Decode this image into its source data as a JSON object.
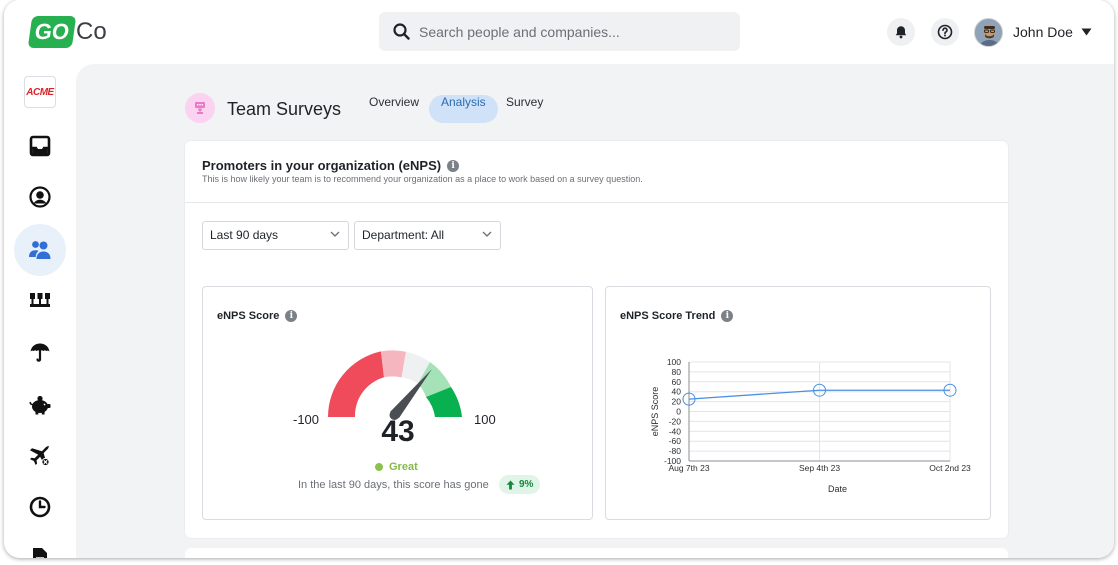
{
  "brand": {
    "logo_go": "GO",
    "logo_co": "Co",
    "company_badge": "ACME"
  },
  "search": {
    "placeholder": "Search people and companies..."
  },
  "user": {
    "name": "John Doe"
  },
  "sidebar": {
    "items": [
      {
        "icon": "inbox-icon"
      },
      {
        "icon": "user-circle-icon"
      },
      {
        "icon": "team-icon",
        "active": true
      },
      {
        "icon": "org-chart-icon"
      },
      {
        "icon": "umbrella-icon"
      },
      {
        "icon": "piggy-bank-icon"
      },
      {
        "icon": "airplane-icon"
      },
      {
        "icon": "clock-icon"
      },
      {
        "icon": "document-icon"
      }
    ]
  },
  "page": {
    "title": "Team Surveys",
    "tabs": [
      {
        "label": "Overview"
      },
      {
        "label": "Analysis",
        "active": true
      },
      {
        "label": "Survey"
      }
    ]
  },
  "enps_card": {
    "title": "Promoters in your organization (eNPS)",
    "subtitle": "This is how likely your team is to recommend your organization as a place to work based on a survey question.",
    "filters": {
      "period": "Last 90 days",
      "department": "Department: All"
    },
    "score_panel": {
      "title": "eNPS Score",
      "min_label": "-100",
      "max_label": "100",
      "score": "43",
      "status": "Great",
      "note": "In the last 90 days, this score has gone",
      "change": "9%"
    },
    "trend_panel": {
      "title": "eNPS Score Trend"
    }
  },
  "colors": {
    "accent_green": "#27b04f",
    "gauge_red": "#ef4b5b",
    "gauge_pink": "#f6b6bf",
    "gauge_light": "#eef0f2",
    "gauge_lightgreen": "#a5e2b8",
    "gauge_green": "#08b04f",
    "line_blue": "#4a90e2"
  },
  "chart_data": {
    "type": "line",
    "x": [
      "Aug 7th 23",
      "Sep 4th 23",
      "Oct 2nd 23"
    ],
    "series": [
      {
        "values": [
          25,
          43,
          43
        ]
      }
    ],
    "xlabel": "Date",
    "ylabel": "eNPS Score",
    "ylim": [
      -100,
      100
    ],
    "yticks": [
      "100",
      "80",
      "60",
      "40",
      "20",
      "0",
      "-20",
      "-40",
      "-60",
      "-80",
      "-100"
    ],
    "grid": true
  }
}
